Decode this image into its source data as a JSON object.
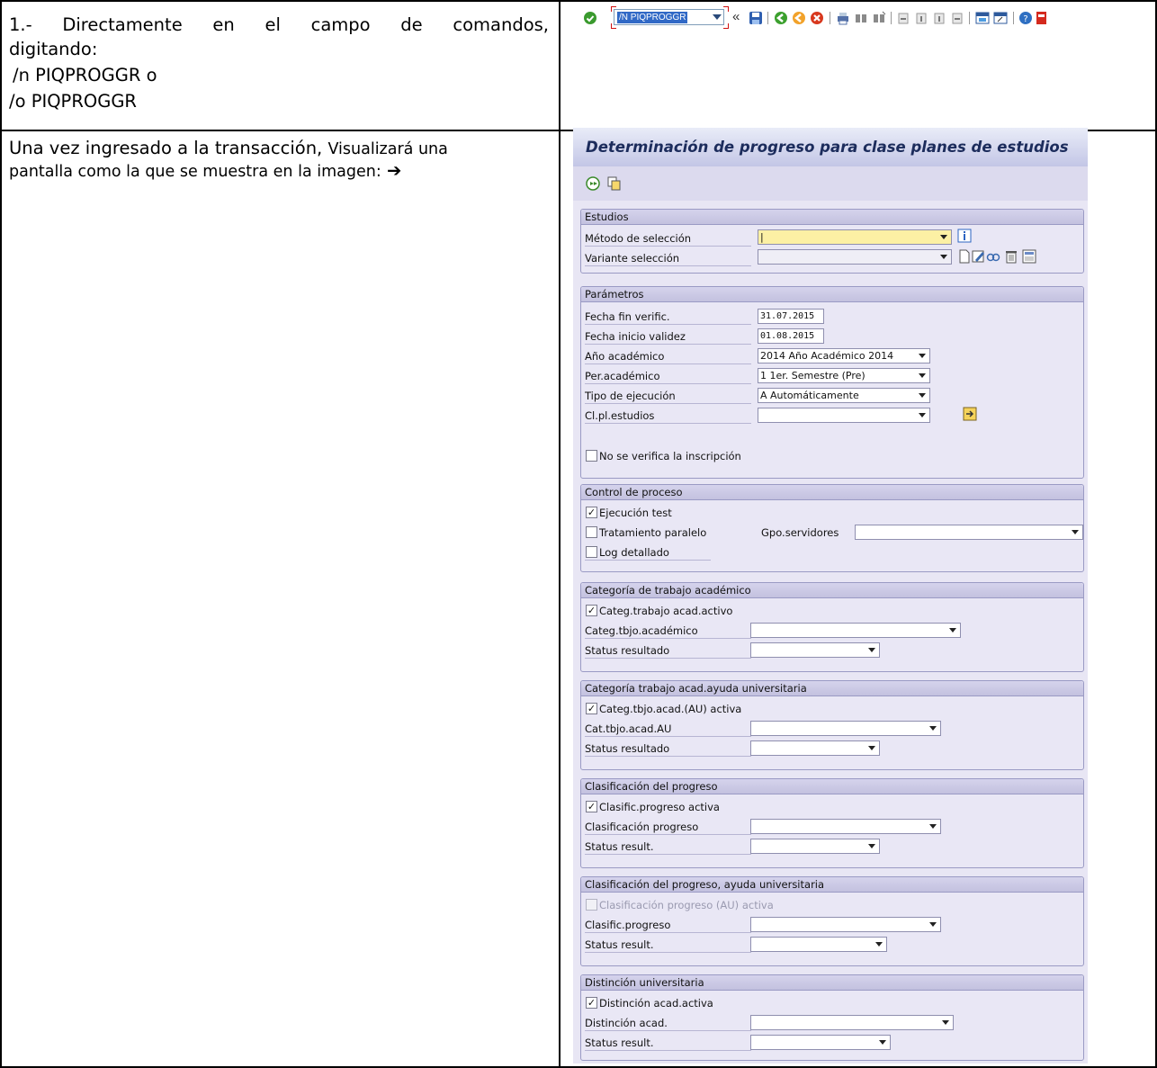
{
  "document": {
    "cell1": {
      "line1": "1.- Directamente en el campo de comandos,",
      "line2": "digitando:",
      "line3": "/n PIQPROGGR o",
      "line4": "/o PIQPROGGR"
    },
    "cell2": {
      "text_a": "Una vez ingresado a la transacción,",
      "text_b": "Visualizará una",
      "text_c": "pantalla como la que se muestra en la imagen:",
      "arrow": "➔"
    }
  },
  "toolbar": {
    "command_value": "/N PIQPROGGR",
    "more": "«",
    "icons": [
      "enter-icon",
      "save-icon",
      "back-icon",
      "exit-icon",
      "cancel-icon",
      "print-icon",
      "find-icon",
      "find-next-icon",
      "first-page-icon",
      "prev-page-icon",
      "next-page-icon",
      "last-page-icon",
      "new-session-icon",
      "shortcut-icon",
      "help-icon",
      "customize-icon"
    ]
  },
  "sap": {
    "title": "Determinación de progreso para clase planes de estudios",
    "appbar_icons": [
      "execute-icon",
      "get-variant-icon"
    ],
    "groups": {
      "estudios": {
        "title": "Estudios",
        "metodo_label": "Método de selección",
        "variante_label": "Variante selección"
      },
      "parametros": {
        "title": "Parámetros",
        "fecha_fin_label": "Fecha fin verific.",
        "fecha_fin_value": "31.07.2015",
        "fecha_inicio_label": "Fecha inicio validez",
        "fecha_inicio_value": "01.08.2015",
        "anio_label": "Año académico",
        "anio_value": "2014 Año Académico 2014",
        "per_label": "Per.académico",
        "per_value": "1 1er. Semestre (Pre)",
        "tipo_label": "Tipo de ejecución",
        "tipo_value": "A Automáticamente",
        "clpl_label": "Cl.pl.estudios",
        "no_verifica_label": "No se verifica la inscripción"
      },
      "control": {
        "title": "Control de proceso",
        "ejecucion_test": "Ejecución test",
        "tratamiento_paralelo": "Tratamiento paralelo",
        "gpo_servidores": "Gpo.servidores",
        "log_detallado": "Log detallado"
      },
      "categoria": {
        "title": "Categoría de trabajo académico",
        "activo": "Categ.trabajo acad.activo",
        "categ_label": "Categ.tbjo.académico",
        "status_label": "Status resultado"
      },
      "categoria_au": {
        "title": "Categoría trabajo acad.ayuda universitaria",
        "activo": "Categ.tbjo.acad.(AU) activa",
        "categ_label": "Cat.tbjo.acad.AU",
        "status_label": "Status resultado"
      },
      "clasificacion": {
        "title": "Clasificación del progreso",
        "activo": "Clasific.progreso activa",
        "clas_label": "Clasificación progreso",
        "status_label": "Status result."
      },
      "clasificacion_au": {
        "title": "Clasificación del progreso, ayuda universitaria",
        "activo": "Clasificación progreso (AU) activa",
        "clas_label": "Clasific.progreso",
        "status_label": "Status result."
      },
      "distincion": {
        "title": "Distinción universitaria",
        "activo": "Distinción acad.activa",
        "dist_label": "Distinción acad.",
        "status_label": "Status result."
      }
    }
  }
}
